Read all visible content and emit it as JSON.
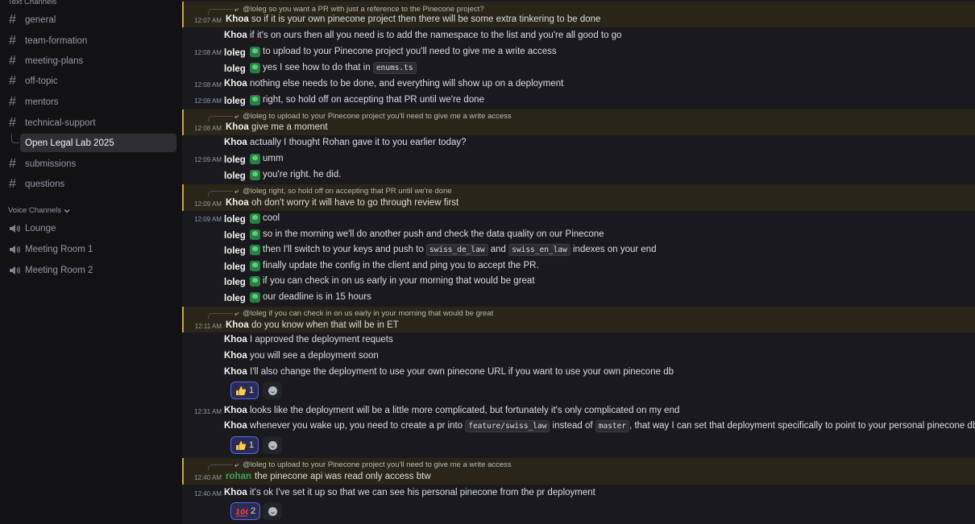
{
  "sidebar": {
    "text_channels_label": "Text Channels",
    "voice_channels_label": "Voice Channels",
    "channels": [
      {
        "name": "general"
      },
      {
        "name": "team-formation"
      },
      {
        "name": "meeting-plans"
      },
      {
        "name": "off-topic"
      },
      {
        "name": "mentors"
      },
      {
        "name": "technical-support"
      }
    ],
    "thread": {
      "name": "Open Legal Lab 2025"
    },
    "channels_after": [
      {
        "name": "submissions"
      },
      {
        "name": "questions"
      }
    ],
    "voice": [
      {
        "name": "Lounge"
      },
      {
        "name": "Meeting Room 1"
      },
      {
        "name": "Meeting Room 2"
      }
    ]
  },
  "messages": [
    {
      "reply": "@loleg so you want a PR with just a reference to the Pinecone project?",
      "time": "12:07 AM",
      "author": "Khoa",
      "text": "so if it is your own pinecone project then there will be some extra tinkering to be done"
    },
    {
      "author": "Khoa",
      "text": "if it's on ours then all you need is to add the namespace to the list and you're all good to go"
    },
    {
      "time": "12:08 AM",
      "author": "loleg",
      "text": "to upload to your Pinecone project you'll need to give me a write access"
    },
    {
      "author": "loleg",
      "text_before": "yes I see how to do that in",
      "code": "enums.ts"
    },
    {
      "time": "12:08 AM",
      "author": "Khoa",
      "text": "nothing else needs to be done, and everything will show up on a deployment"
    },
    {
      "time": "12:08 AM",
      "author": "loleg",
      "text": "right, so hold off on accepting that PR until we're done"
    },
    {
      "reply": "@loleg to upload to your Pinecone project you'll need to give me a write access",
      "time": "12:08 AM",
      "author": "Khoa",
      "text": "give me a moment"
    },
    {
      "author": "Khoa",
      "text": "actually I thought Rohan gave it to you earlier today?"
    },
    {
      "time": "12:09 AM",
      "author": "loleg",
      "text": "umm"
    },
    {
      "author": "loleg",
      "text": "you're right. he did."
    },
    {
      "reply": "@loleg right, so hold off on accepting that PR until we're done",
      "time": "12:09 AM",
      "author": "Khoa",
      "text": "oh don't worry it will have to go through review first"
    },
    {
      "time": "12:09 AM",
      "author": "loleg",
      "text": "cool"
    },
    {
      "author": "loleg",
      "text": "so in the morning we'll do another push and check the data quality on our Pinecone"
    },
    {
      "author": "loleg",
      "text_a": "then I'll switch to your keys and push to",
      "code_a": "swiss_de_law",
      "text_b": "and",
      "code_b": "swiss_en_law",
      "text_c": "indexes on your end"
    },
    {
      "author": "loleg",
      "text": "finally update the config in the client and ping you to accept the PR."
    },
    {
      "author": "loleg",
      "text": "if you can check in on us early in your morning that would be great"
    },
    {
      "author": "loleg",
      "text": "our deadline is in 15 hours"
    },
    {
      "reply": "@loleg if you can check in on us early in your morning that would be great",
      "time": "12:11 AM",
      "author": "Khoa",
      "text": "do you know when that will be in ET"
    },
    {
      "author": "Khoa",
      "text": "I approved the deployment requets"
    },
    {
      "author": "Khoa",
      "text": "you will see a deployment soon"
    },
    {
      "author": "Khoa",
      "text": "I'll also change the deployment to use your own pinecone URL if you want to use your own pinecone db",
      "reaction": {
        "emoji": "thumbs-up",
        "count": "1"
      }
    },
    {
      "time": "12:31 AM",
      "author": "Khoa",
      "text": "looks like the deployment will be a little more complicated, but fortunately it's only complicated on my end"
    },
    {
      "author": "Khoa",
      "text_a": "whenever you wake up, you need to create a pr into",
      "code_a": "feature/swiss_law",
      "text_b": "instead of",
      "code_b": "master",
      "text_c": ", that way I can set that deployment specifically to point to your personal pinecone db",
      "reaction": {
        "emoji": "thumbs-up",
        "count": "1"
      }
    },
    {
      "reply": "@loleg to upload to your Pinecone project you'll need to give me a write access",
      "time": "12:40 AM",
      "author": "rohan",
      "text": "the pinecone api was read only access btw"
    },
    {
      "time": "12:40 AM",
      "author": "Khoa",
      "text": "it's ok I've set it up so that we can see his personal pinecone from the pr deployment",
      "reaction": {
        "emoji": "hundred-points",
        "count": "2"
      }
    }
  ],
  "colors": {
    "accent": "#5865f2",
    "mention_bar": "#c9a74a",
    "rohan": "#3ba55c",
    "bg": "#1a1a1e",
    "sidebar": "#121214"
  }
}
